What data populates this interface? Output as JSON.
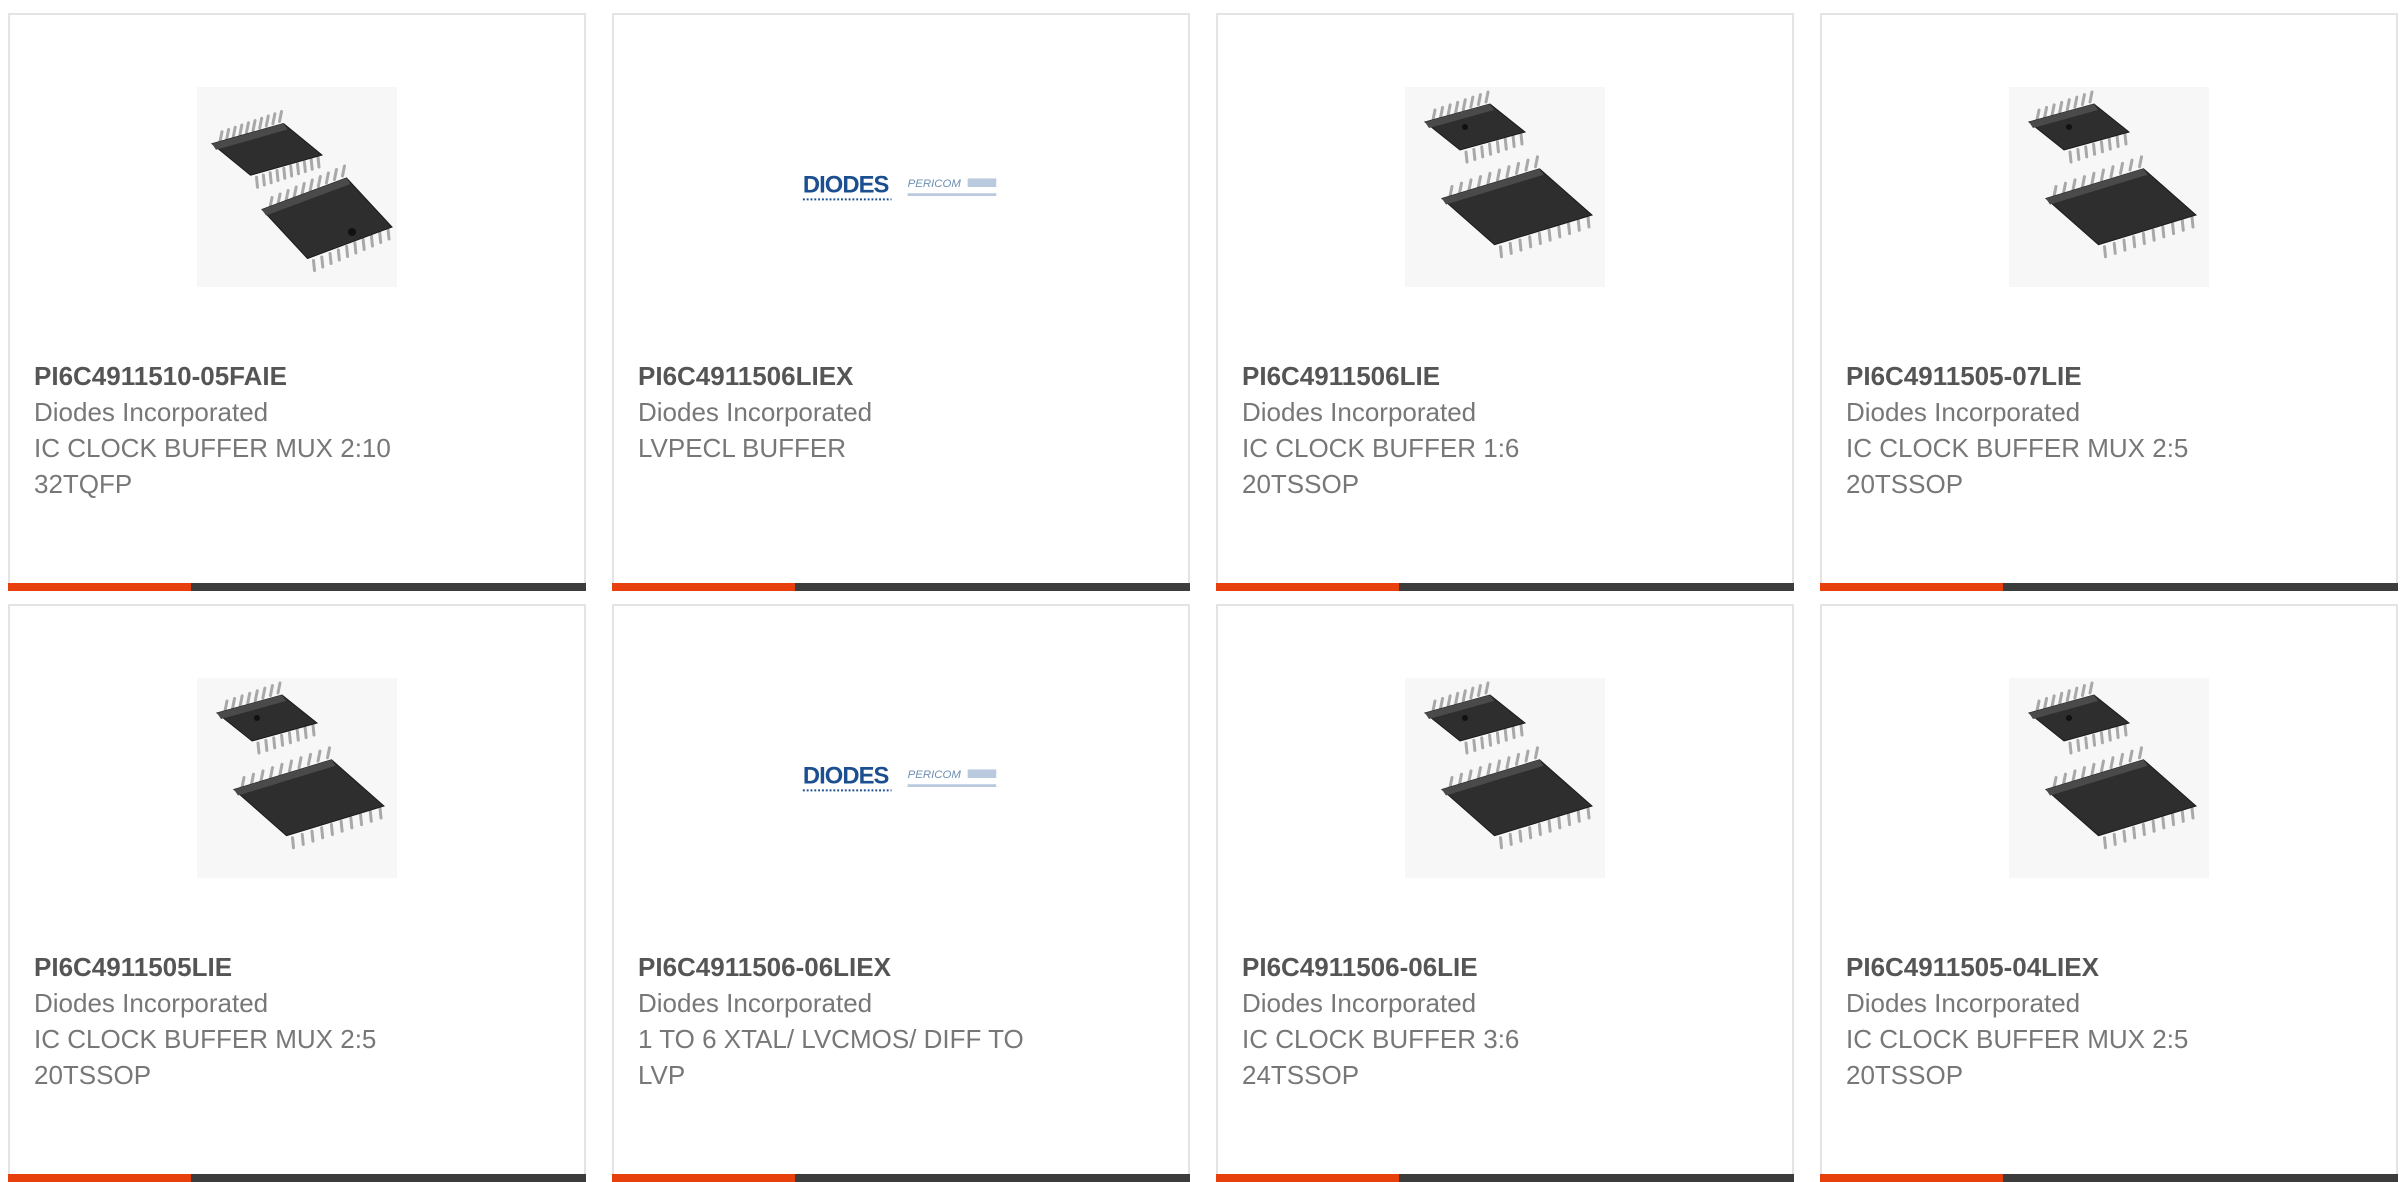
{
  "accent_color": "#e8400c",
  "bar_color": "#3c3c3c",
  "products": [
    {
      "part_number": "PI6C4911510-05FAIE",
      "manufacturer": "Diodes Incorporated",
      "description": "IC CLOCK BUFFER MUX 2:10 32TQFP",
      "image": "tqfp-chip-icon"
    },
    {
      "part_number": "PI6C4911506LIEX",
      "manufacturer": "Diodes Incorporated",
      "description": "LVPECL BUFFER",
      "image": "diodes-pericom-logo",
      "logo_text": "DIODES",
      "logo_sub": "PERICOM"
    },
    {
      "part_number": "PI6C4911506LIE",
      "manufacturer": "Diodes Incorporated",
      "description": "IC CLOCK BUFFER 1:6 20TSSOP",
      "image": "tssop-chip-icon"
    },
    {
      "part_number": "PI6C4911505-07LIE",
      "manufacturer": "Diodes Incorporated",
      "description": "IC CLOCK BUFFER MUX 2:5 20TSSOP",
      "image": "tssop-chip-icon"
    },
    {
      "part_number": "PI6C4911505LIE",
      "manufacturer": "Diodes Incorporated",
      "description": "IC CLOCK BUFFER MUX 2:5 20TSSOP",
      "image": "tssop-chip-icon"
    },
    {
      "part_number": "PI6C4911506-06LIEX",
      "manufacturer": "Diodes Incorporated",
      "description": "1 TO 6 XTAL/ LVCMOS/ DIFF TO LVP",
      "image": "diodes-pericom-logo",
      "logo_text": "DIODES",
      "logo_sub": "PERICOM"
    },
    {
      "part_number": "PI6C4911506-06LIE",
      "manufacturer": "Diodes Incorporated",
      "description": "IC CLOCK BUFFER 3:6 24TSSOP",
      "image": "tssop-chip-icon"
    },
    {
      "part_number": "PI6C4911505-04LIEX",
      "manufacturer": "Diodes Incorporated",
      "description": "IC CLOCK BUFFER MUX 2:5 20TSSOP",
      "image": "tssop-chip-icon"
    }
  ]
}
